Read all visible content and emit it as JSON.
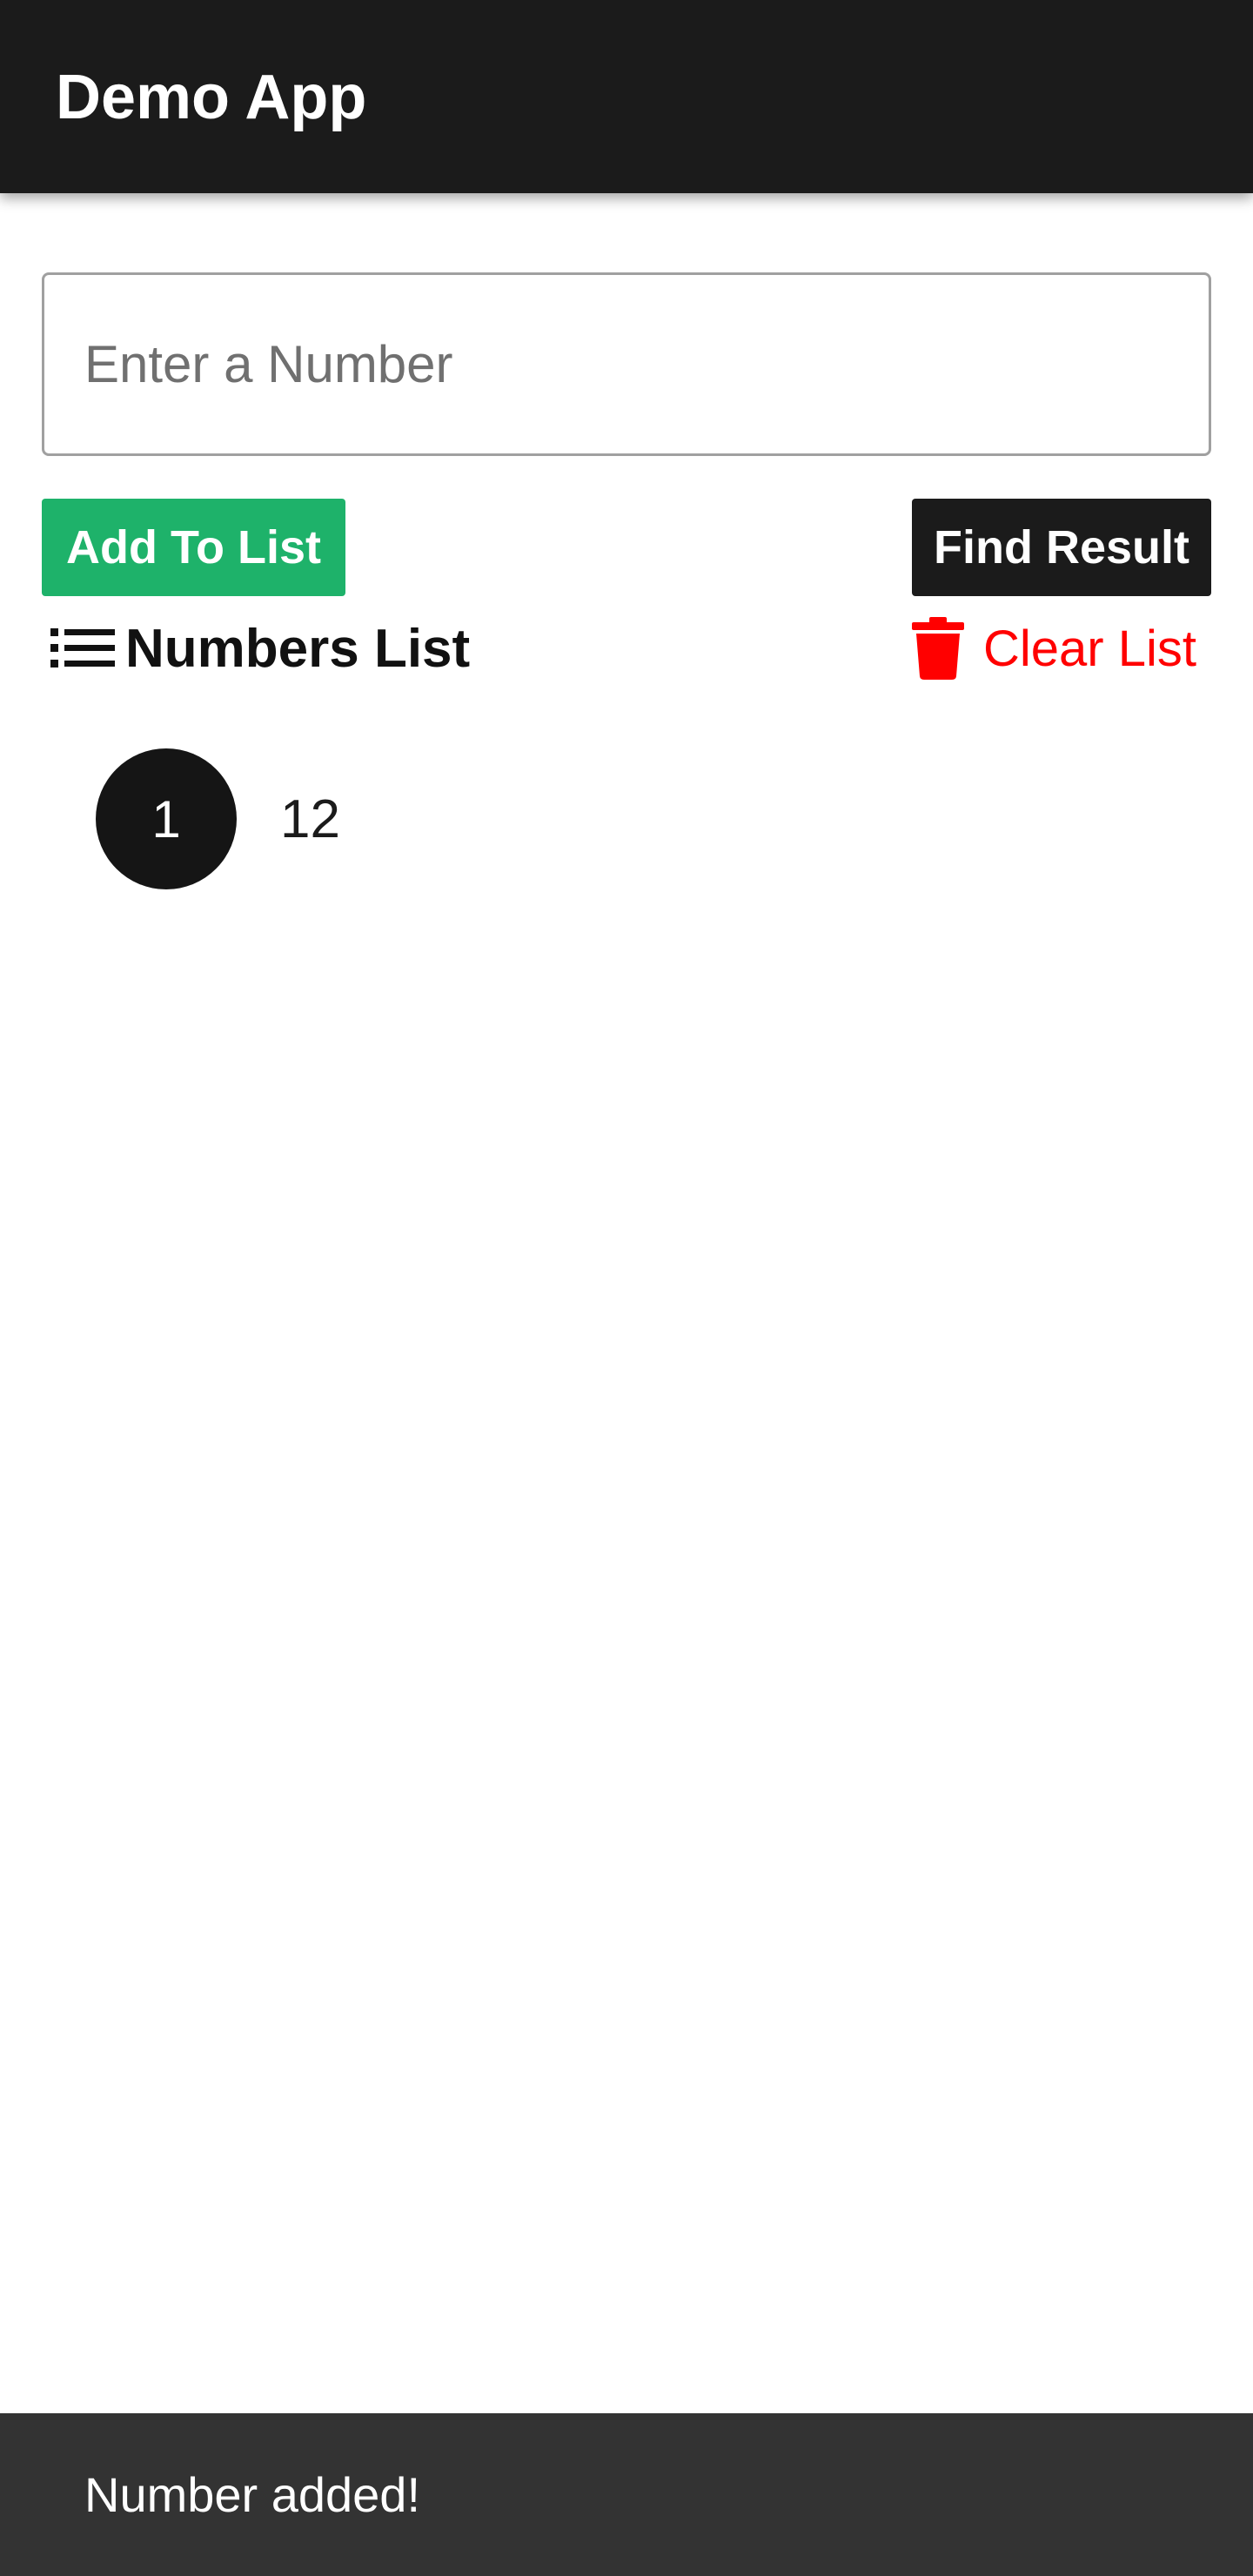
{
  "app": {
    "title": "Demo App"
  },
  "number_input": {
    "placeholder": "Enter a Number",
    "value": ""
  },
  "actions": {
    "add_label": "Add To List",
    "find_label": "Find Result"
  },
  "numbers_list": {
    "title": "Numbers List",
    "title_icon": "list-icon",
    "clear_label": "Clear List",
    "clear_icon": "trash-icon",
    "items": [
      {
        "index": "1",
        "value": "12"
      }
    ]
  },
  "snackbar": {
    "message": "Number added!"
  },
  "colors": {
    "appbar": "#1b1b1b",
    "add_button": "#1eb26a",
    "find_button": "#1b1b1b",
    "clear_list": "#ff0000",
    "snackbar": "#333333"
  }
}
